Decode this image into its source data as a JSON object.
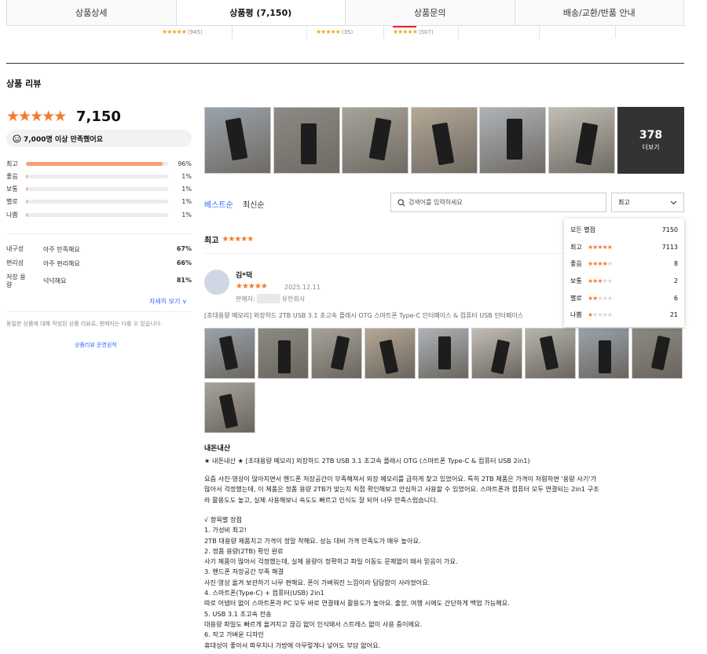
{
  "tabs": [
    "상품상세",
    "상품평 (7,150)",
    "상품문의",
    "배송/교환/반품 안내"
  ],
  "subrow": [
    {
      "stars": "★★★★★",
      "count": "(945)"
    },
    {
      "stars": "★★★★★",
      "count": "(35)"
    },
    {
      "stars": "★★★★★",
      "count": "(507)"
    }
  ],
  "section_title": "상품 리뷰",
  "summary": {
    "stars": "★★★★★",
    "count": "7,150",
    "satisfied": "7,000명 이상 만족했어요"
  },
  "distribution": [
    {
      "label": "최고",
      "pct": "96%",
      "value": 0.96
    },
    {
      "label": "좋음",
      "pct": "1%",
      "value": 0.01
    },
    {
      "label": "보통",
      "pct": "1%",
      "value": 0.01
    },
    {
      "label": "별로",
      "pct": "1%",
      "value": 0.01
    },
    {
      "label": "나쁨",
      "pct": "1%",
      "value": 0.01
    }
  ],
  "attributes": [
    {
      "key": "내구성",
      "value": "아주 만족해요",
      "pct": "67%"
    },
    {
      "key": "편리성",
      "value": "아주 편리해요",
      "pct": "66%"
    },
    {
      "key": "저장 용량",
      "value": "넉넉해요",
      "pct": "81%"
    }
  ],
  "more_link": "자세히 보기 ∨",
  "note": "동일한 상품에 대해 작성된 상품 리뷰로, 판매자는 다를 수 있습니다.",
  "policy_link": "상품리뷰 운영원칙",
  "photo_more": {
    "count": "378",
    "label": "더보기"
  },
  "sort": {
    "best": "베스트순",
    "recent": "최신순"
  },
  "search": {
    "placeholder": "검색어를 입력하세요"
  },
  "select": {
    "value": "최고"
  },
  "dropdown": [
    {
      "label": "모든 별점",
      "stars": 0,
      "count": "7150"
    },
    {
      "label": "최고",
      "stars": 5,
      "count": "7113"
    },
    {
      "label": "좋음",
      "stars": 4,
      "count": "8"
    },
    {
      "label": "보통",
      "stars": 3,
      "count": "2"
    },
    {
      "label": "별로",
      "stars": 2,
      "count": "6"
    },
    {
      "label": "나쁨",
      "stars": 1,
      "count": "21"
    }
  ],
  "filter": {
    "label": "최고",
    "stars": "★★★★★"
  },
  "review": {
    "name": "김*덕",
    "stars": "★★★★★",
    "date": "2025.12.11",
    "seller_prefix": "판매자:",
    "seller_suffix": "유한회사",
    "product": "[초대용량 메모리] 외장하드 2TB USB 3.1 초고속 플래시 OTG 스마트폰 Type-C 인터페이스 & 컴퓨터 USB 인터페이스",
    "headline": "내돈내산",
    "line1": "★ 내돈내산 ★ [초대용량 메모리] 외장하드 2TB USB 3.1 초고속 플래시 OTG (스마트폰 Type-C & 컴퓨터 USB 2in1)",
    "para1": [
      "요즘 사진·영상이 많아지면서 핸드폰 저장공간이 부족해져서 외장 메모리를 급하게 찾고 있었어요. 특히 2TB 제품은 가격이 저렴하면 '용량 사기'가",
      "많아서 걱정했는데, 이 제품은 정품 용량 2TB가 맞는지 직접 확인해보고 안심하고 사용할 수 있었어요. 스마트폰과 컴퓨터 모두 연결되는 2in1 구조",
      "라 활용도도 높고, 실제 사용해보니 속도도 빠르고 인식도 잘 되어 너무 만족스럽습니다."
    ],
    "para2": [
      "√ 항목별 장점",
      "1. 가성비 최고!",
      "2TB 대용량 제품치고 가격이 정말 착해요. 성능 대비 가격 만족도가 매우 높아요.",
      "2. 정품 용량(2TB) 확인 완료",
      "사기 제품이 많아서 걱정했는데, 실제 용량이 정확하고 파일 이동도 문제없이 돼서 믿음이 가요.",
      "3. 핸드폰 저장공간 부족 해결",
      "사진·영상 옮겨 보관하기 너무 편해요. 폰이 가벼워진 느낌이라 답답함이 사라졌어요.",
      "4. 스마트폰(Type-C) + 컴퓨터(USB) 2in1",
      "따로 어댑터 없이 스마트폰과 PC 모두 바로 연결돼서 활용도가 높아요. 출장, 여행 시에도 간단하게 백업 가능해요.",
      "5. USB 3.1 초고속 전송",
      "대용량 파일도 빠르게 옮겨지고 끊김 없이 인식돼서 스트레스 없이 사용 중이에요.",
      "6. 작고 가벼운 디자인",
      "휴대성이 좋아서 파우치나 가방에 아무렇게나 넣어도 부담 없어요."
    ]
  }
}
